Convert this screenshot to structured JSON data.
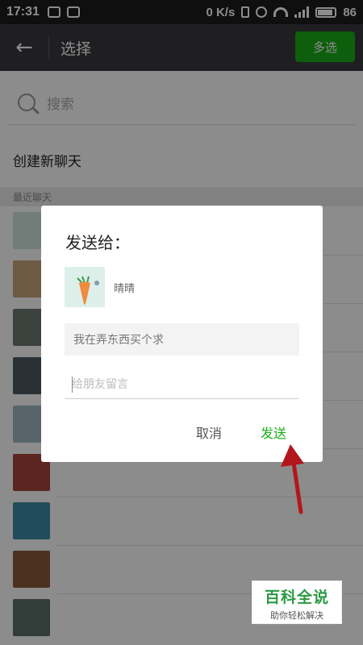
{
  "status_bar": {
    "time": "17:31",
    "network_speed": "0 K/s",
    "battery": "86"
  },
  "header": {
    "back_icon": "arrow-left-icon",
    "title": "选择",
    "multi_select": "多选"
  },
  "search": {
    "placeholder": "搜索"
  },
  "new_chat": "创建新聊天",
  "recent_header": "最近聊天",
  "dialog": {
    "title": "发送给：",
    "recipient_name": "晴晴",
    "message_preview": "我在弄东西买个求",
    "input_placeholder": "给朋友留言",
    "cancel": "取消",
    "send": "发送"
  },
  "watermark": {
    "title": "百科全说",
    "subtitle": "助你轻松解决"
  },
  "colors": {
    "accent_green": "#1aad19",
    "titlebar": "#393a3f",
    "annotation_arrow": "#b3161c"
  }
}
